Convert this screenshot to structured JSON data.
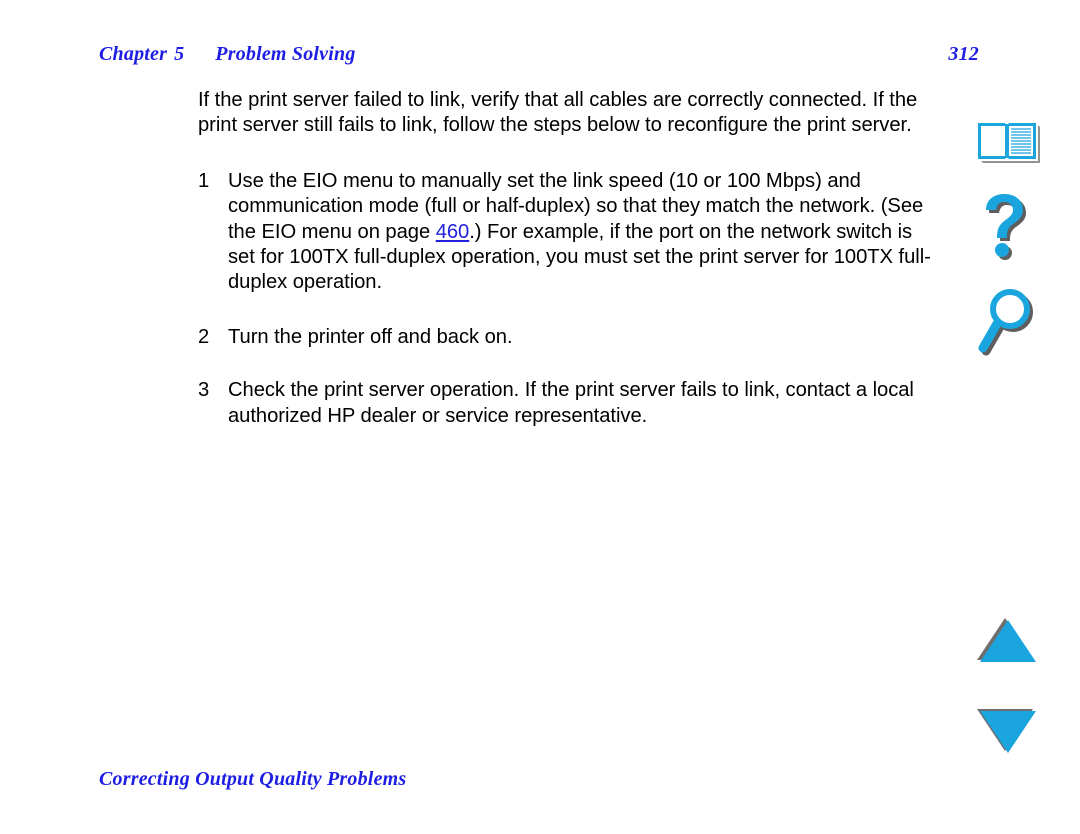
{
  "document": {
    "header": {
      "chapter_word": "Chapter",
      "chapter_number": "5",
      "title": "Problem Solving",
      "page_number": "312"
    },
    "footer": {
      "section_title": "Correcting Output Quality Problems"
    },
    "body": {
      "intro_paragraph": "If the print server failed to link, verify that all cables are correctly connected. If the print server still fails to link, follow the steps below to reconfigure the print server.",
      "steps": [
        {
          "number": "1",
          "text_before_link": "Use the EIO menu to manually set the link speed (10 or 100 Mbps) and communication mode (full or half-duplex) so that they match the network. (See the EIO menu on page ",
          "link_label": "460",
          "text_after_link": ".) For example, if the port on the network switch is set for 100TX full-duplex operation, you must set the print server for 100TX full-duplex operation."
        },
        {
          "number": "2",
          "text_before_link": "Turn the printer off and back on.",
          "link_label": "",
          "text_after_link": ""
        },
        {
          "number": "3",
          "text_before_link": "Check the print server operation. If the print server fails to link, contact a local authorized HP dealer or service representative.",
          "link_label": "",
          "text_after_link": ""
        }
      ]
    }
  },
  "navigation": {
    "buttons": [
      {
        "name": "book-icon",
        "label": "Table of Contents"
      },
      {
        "name": "question-mark-icon",
        "label": "Help"
      },
      {
        "name": "magnifier-icon",
        "label": "Search"
      },
      {
        "name": "triangle-up-icon",
        "label": "Previous Page"
      },
      {
        "name": "triangle-down-icon",
        "label": "Next Page"
      }
    ]
  },
  "colors": {
    "heading_blue": "#1d1de4",
    "link_blue": "#2222dd",
    "icon_cyan": "#1aa5de",
    "icon_shadow": "#6e6e6e",
    "body_text": "#000000",
    "page_background": "#ffffff"
  }
}
